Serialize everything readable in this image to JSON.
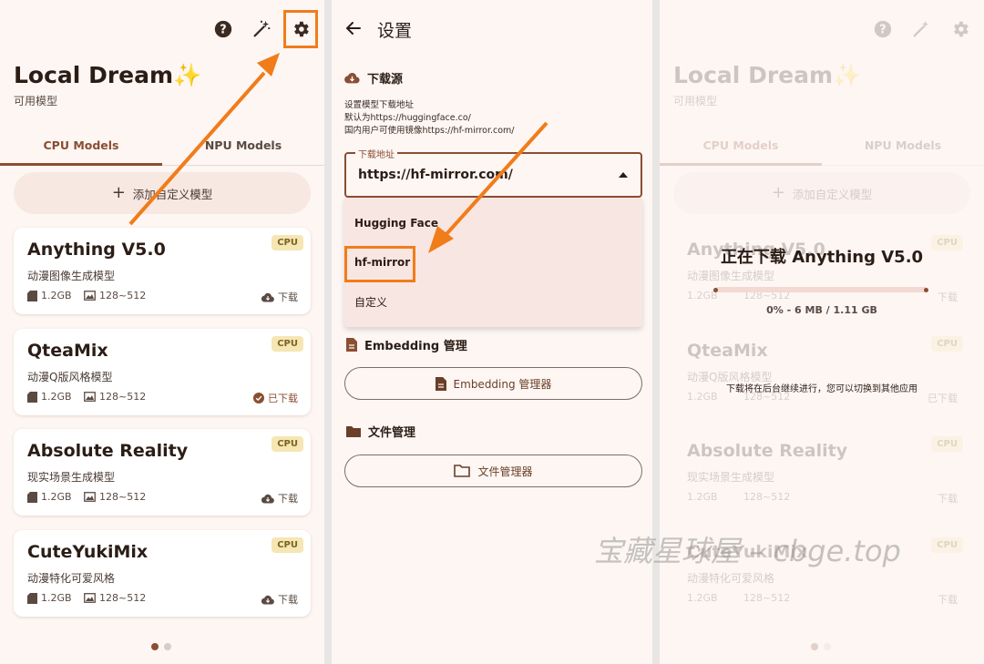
{
  "accent": "#8a4e32",
  "highlight_color": "#f17c1a",
  "panel1": {
    "toolbar_icons": [
      "help-icon",
      "magic-wand-icon",
      "settings-icon"
    ],
    "title": "Local Dream✨",
    "subtitle": "可用模型",
    "tabs": [
      {
        "label": "CPU Models",
        "active": true
      },
      {
        "label": "NPU Models",
        "active": false
      }
    ],
    "add_button": {
      "icon": "plus-icon",
      "label": "添加自定义模型"
    },
    "models": [
      {
        "name": "Anything V5.0",
        "desc": "动漫图像生成模型",
        "badge": "CPU",
        "size": "1.2GB",
        "resolution": "128~512",
        "status": "下载",
        "downloaded": false
      },
      {
        "name": "QteaMix",
        "desc": "动漫Q版风格模型",
        "badge": "CPU",
        "size": "1.2GB",
        "resolution": "128~512",
        "status": "已下载",
        "downloaded": true
      },
      {
        "name": "Absolute Reality",
        "desc": "现实场景生成模型",
        "badge": "CPU",
        "size": "1.2GB",
        "resolution": "128~512",
        "status": "下载",
        "downloaded": false
      },
      {
        "name": "CuteYukiMix",
        "desc": "动漫特化可爱风格",
        "badge": "CPU",
        "size": "1.2GB",
        "resolution": "128~512",
        "status": "下载",
        "downloaded": false
      }
    ],
    "page_indicator": {
      "count": 2,
      "active": 0
    }
  },
  "panel2": {
    "back_icon": "back-arrow-icon",
    "title": "设置",
    "download_source": {
      "heading": "下载源",
      "icon": "cloud-download-icon",
      "desc_lines": [
        "设置模型下载地址",
        "默认为https://huggingface.co/",
        "国内用户可使用镜像https://hf-mirror.com/"
      ],
      "field_label": "下载地址",
      "field_value": "https://hf-mirror.com/",
      "options": [
        "Hugging Face",
        "hf-mirror",
        "自定义"
      ]
    },
    "embedding": {
      "heading": "Embedding 管理",
      "icon": "file-icon",
      "button": "Embedding 管理器"
    },
    "files": {
      "heading": "文件管理",
      "icon": "folder-icon",
      "button": "文件管理器"
    }
  },
  "panel3": {
    "downloading_title": "正在下载 Anything V5.0",
    "progress": 0.0,
    "size_text": "0% - 6 MB / 1.11 GB",
    "note": "下载将在后台继续进行，您可以切换到其他应用"
  },
  "watermark": "宝藏星球屋 – cbge.top"
}
